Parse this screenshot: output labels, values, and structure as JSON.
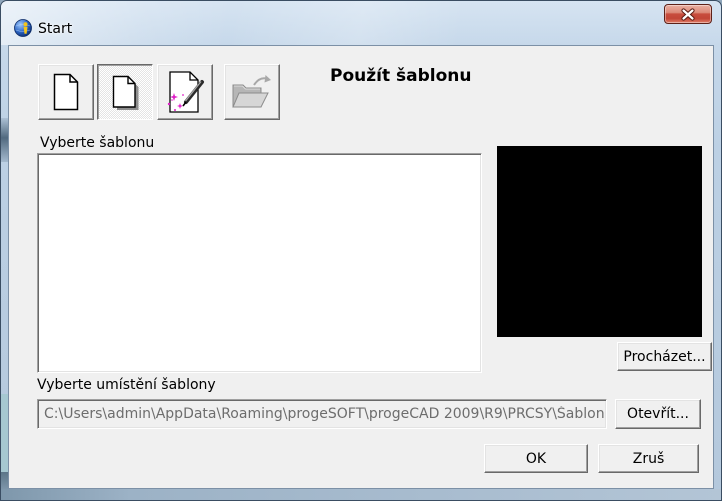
{
  "window": {
    "title": "Start",
    "title_icon": "app-globe-icon",
    "close_icon": "close-icon"
  },
  "toolbar": {
    "buttons": [
      {
        "icon": "blank-page-icon",
        "pressed": false,
        "disabled": false
      },
      {
        "icon": "template-page-icon",
        "pressed": true,
        "disabled": false
      },
      {
        "icon": "wizard-page-icon",
        "pressed": false,
        "disabled": false
      },
      {
        "icon": "open-folder-icon",
        "pressed": false,
        "disabled": true
      }
    ]
  },
  "heading": "Použít šablonu",
  "template_list": {
    "label": "Vyberte šablonu"
  },
  "browse_button": "Procházet...",
  "location": {
    "label": "Vyberte umístění šablony",
    "path": "C:\\Users\\admin\\AppData\\Roaming\\progeSOFT\\progeCAD 2009\\R9\\PRCSY\\Šablon",
    "open_button": "Otevřít..."
  },
  "dialog_buttons": {
    "ok": "OK",
    "cancel": "Zruš"
  },
  "colors": {
    "client_bg": "#f0f0f0",
    "glass": "#bcd0e4",
    "close_button": "#c84d3e",
    "preview_bg": "#000000",
    "disabled_text": "#6d6d6d"
  }
}
